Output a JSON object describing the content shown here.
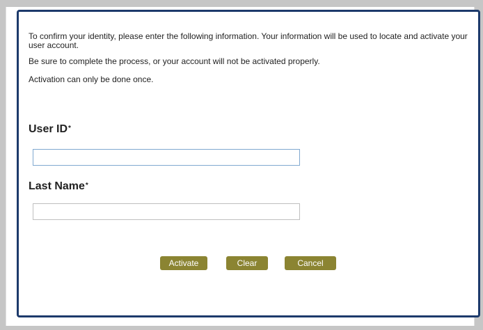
{
  "intro": {
    "line1": "To confirm your identity, please enter the following information. Your information will be used to locate and activate your user account.",
    "line2": "Be sure to complete the process, or your account will not be activated properly.",
    "line3": "Activation can only be done once."
  },
  "form": {
    "user_id": {
      "label": "User ID",
      "required_marker": "*",
      "value": "",
      "placeholder": ""
    },
    "last_name": {
      "label": "Last Name",
      "required_marker": "*",
      "value": "",
      "placeholder": ""
    }
  },
  "buttons": {
    "activate": "Activate",
    "clear": "Clear",
    "cancel": "Cancel"
  },
  "colors": {
    "panel_border": "#1d3a6b",
    "button_bg": "#8b8432",
    "page_bg": "#c6c6c6"
  }
}
